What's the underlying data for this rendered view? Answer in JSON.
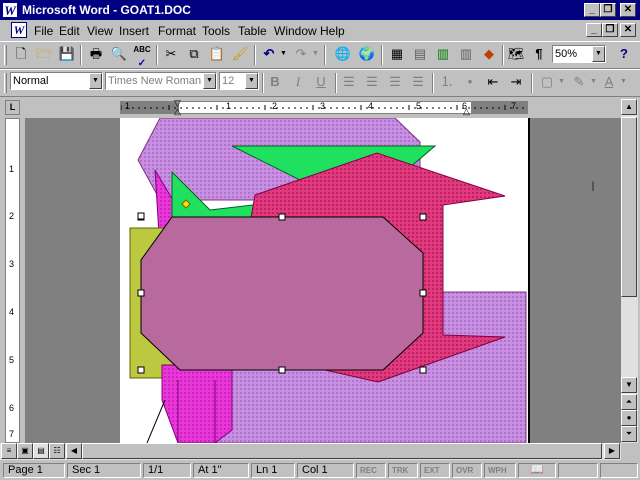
{
  "window": {
    "title": "Microsoft Word - GOAT1.DOC",
    "app_icon": "W"
  },
  "menu": {
    "items": [
      "File",
      "Edit",
      "View",
      "Insert",
      "Format",
      "Tools",
      "Table",
      "Window",
      "Help"
    ]
  },
  "formatting": {
    "style": "Normal",
    "font": "Times New Roman",
    "size": "12"
  },
  "standard": {
    "zoom": "50%"
  },
  "ruler": {
    "h_labels": [
      "1",
      "1",
      "2",
      "3",
      "4",
      "5",
      "6",
      "7"
    ],
    "v_labels": [
      "1",
      "2",
      "3",
      "4",
      "5",
      "6",
      "7"
    ]
  },
  "status": {
    "page": "Page 1",
    "section": "Sec 1",
    "pages": "1/1",
    "at": "At 1\"",
    "line": "Ln 1",
    "col": "Col 1",
    "rec": "REC",
    "trk": "TRK",
    "ext": "EXT",
    "ovr": "OVR",
    "wph": "WPH"
  },
  "icons": [
    "word-app-icon",
    "new-document-icon",
    "open-icon",
    "save-icon",
    "print-icon",
    "print-preview-icon",
    "spelling-icon",
    "cut-icon",
    "copy-icon",
    "paste-icon",
    "format-painter-icon",
    "undo-icon",
    "redo-icon",
    "insert-hyperlink-icon",
    "web-toolbar-icon",
    "tables-borders-icon",
    "insert-table-icon",
    "insert-excel-icon",
    "columns-icon",
    "drawing-icon",
    "document-map-icon",
    "show-hide-icon",
    "help-icon"
  ],
  "colors": {
    "titlebar": "#000080",
    "shape_lavender": "#c890e0",
    "shape_green": "#20e060",
    "shape_crimson": "#e03a80",
    "shape_olive": "#bcc840",
    "shape_mauve": "#b86a9e",
    "shape_magenta": "#e838d8"
  }
}
